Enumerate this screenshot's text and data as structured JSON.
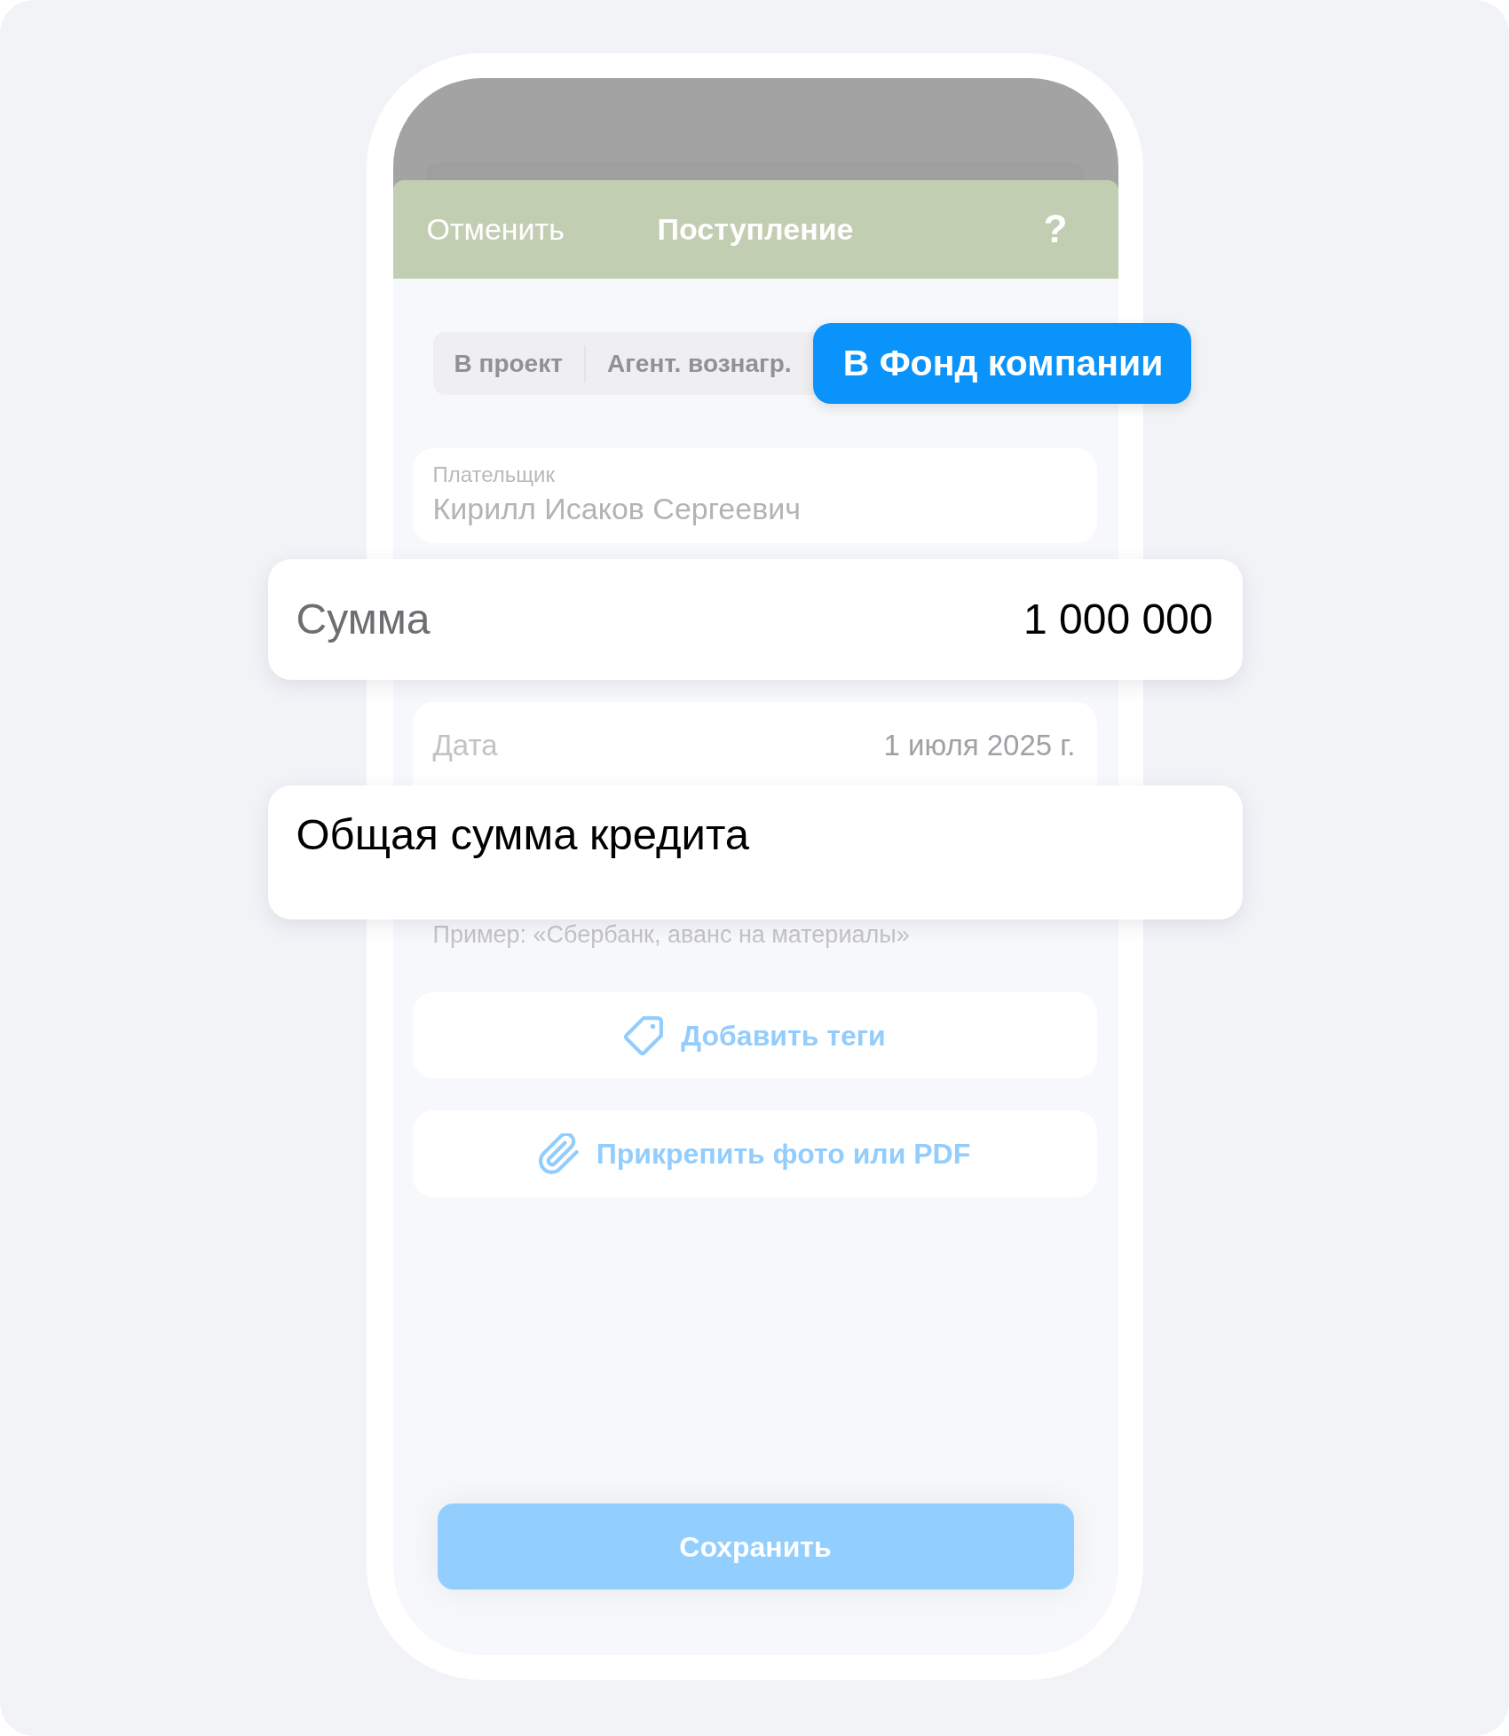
{
  "header": {
    "cancel": "Отменить",
    "title": "Поступление",
    "help": "?"
  },
  "segments": [
    {
      "label": "В проект",
      "selected": false
    },
    {
      "label": "Агент. вознагр.",
      "selected": false
    },
    {
      "label": "В Фонд компании",
      "selected": true
    }
  ],
  "payer": {
    "label": "Плательщик",
    "value": "Кирилл Исаков Сергеевич"
  },
  "amount": {
    "label": "Сумма",
    "value": "1 000 000"
  },
  "date": {
    "label": "Дата",
    "value": "1 июля 2025 г."
  },
  "comment": {
    "value": "Общая сумма кредита",
    "hint": "Пример: «Сбербанк, аванс на материалы»"
  },
  "actions": [
    {
      "kind": "tags",
      "label": "Добавить теги"
    },
    {
      "kind": "attach",
      "label": "Прикрепить фото или PDF"
    }
  ],
  "save_button": {
    "label": "Сохранить"
  }
}
